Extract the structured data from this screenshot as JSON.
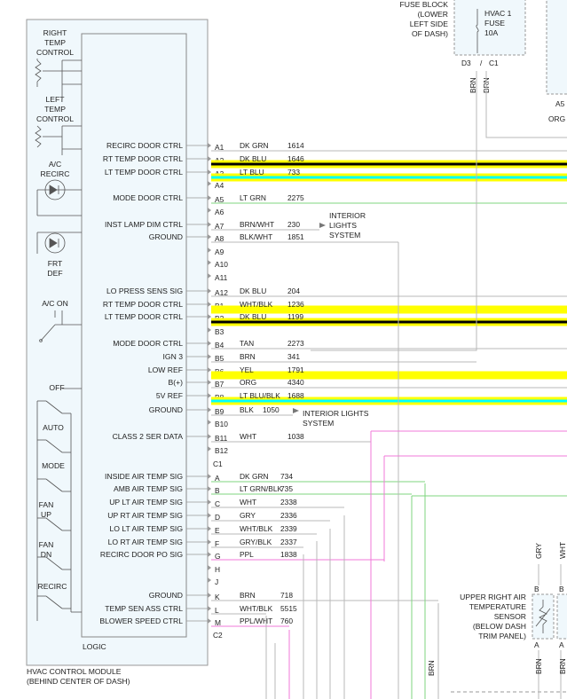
{
  "module": {
    "title_line1": "HVAC CONTROL MODULE",
    "title_line2": "(BEHIND CENTER OF DASH)",
    "logic_label": "LOGIC"
  },
  "switches": {
    "right_temp": [
      "RIGHT",
      "TEMP",
      "CONTROL"
    ],
    "left_temp": [
      "LEFT",
      "TEMP",
      "CONTROL"
    ],
    "ac_recirc": [
      "A/C",
      "RECIRC"
    ],
    "frt_def": [
      "FRT",
      "DEF"
    ],
    "ac_on": "A/C ON",
    "off": "OFF",
    "auto": "AUTO",
    "mode": "MODE",
    "fan_up": [
      "FAN",
      "UP"
    ],
    "fan_dn": [
      "FAN",
      "DN"
    ],
    "recirc": "RECIRC"
  },
  "fuse": {
    "block": [
      "FUSE BLOCK",
      "(LOWER",
      "LEFT SIDE",
      "OF DASH)"
    ],
    "fuse": [
      "HVAC 1",
      "FUSE",
      "10A"
    ],
    "pin_d3": "D3",
    "pin_c1": "C1",
    "wire_1": "BRN",
    "wire_2": "BRN",
    "pin_a5": "A5",
    "wire_org": "ORG"
  },
  "connector_labels": {
    "c1": "C1",
    "c2": "C2"
  },
  "circuits": [
    {
      "signal": "RECIRC DOOR CTRL",
      "pin": "A1",
      "color": "DK GRN",
      "num": "1614"
    },
    {
      "signal": "RT TEMP DOOR CTRL",
      "pin": "A2",
      "color": "DK BLU",
      "num": "1646"
    },
    {
      "signal": "LT TEMP DOOR CTRL",
      "pin": "A3",
      "color": "LT BLU",
      "num": "733"
    },
    {
      "signal": "",
      "pin": "A4",
      "color": "",
      "num": ""
    },
    {
      "signal": "MODE DOOR CTRL",
      "pin": "A5",
      "color": "LT GRN",
      "num": "2275"
    },
    {
      "signal": "",
      "pin": "A6",
      "color": "",
      "num": ""
    },
    {
      "signal": "INST LAMP DIM CTRL",
      "pin": "A7",
      "color": "BRN/WHT",
      "num": "230"
    },
    {
      "signal": "GROUND",
      "pin": "A8",
      "color": "BLK/WHT",
      "num": "1851"
    },
    {
      "signal": "",
      "pin": "A9",
      "color": "",
      "num": ""
    },
    {
      "signal": "",
      "pin": "A10",
      "color": "",
      "num": ""
    },
    {
      "signal": "",
      "pin": "A11",
      "color": "",
      "num": ""
    },
    {
      "signal": "LO PRESS SENS SIG",
      "pin": "A12",
      "color": "DK BLU",
      "num": "204"
    },
    {
      "signal": "RT TEMP DOOR CTRL",
      "pin": "B1",
      "color": "WHT/BLK",
      "num": "1236"
    },
    {
      "signal": "LT TEMP DOOR CTRL",
      "pin": "B2",
      "color": "DK BLU",
      "num": "1199"
    },
    {
      "signal": "",
      "pin": "B3",
      "color": "",
      "num": ""
    },
    {
      "signal": "MODE DOOR CTRL",
      "pin": "B4",
      "color": "TAN",
      "num": "2273"
    },
    {
      "signal": "IGN 3",
      "pin": "B5",
      "color": "BRN",
      "num": "341"
    },
    {
      "signal": "LOW REF",
      "pin": "B6",
      "color": "YEL",
      "num": "1791"
    },
    {
      "signal": "B(+)",
      "pin": "B7",
      "color": "ORG",
      "num": "4340"
    },
    {
      "signal": "5V REF",
      "pin": "B8",
      "color": "LT BLU/BLK",
      "num": "1688"
    },
    {
      "signal": "GROUND",
      "pin": "B9",
      "color": "BLK",
      "num": "1050"
    },
    {
      "signal": "",
      "pin": "B10",
      "color": "",
      "num": ""
    },
    {
      "signal": "CLASS 2 SER DATA",
      "pin": "B11",
      "color": "WHT",
      "num": "1038"
    },
    {
      "signal": "",
      "pin": "B12",
      "color": "",
      "num": ""
    }
  ],
  "circuits_c2": [
    {
      "signal": "INSIDE AIR TEMP SIG",
      "pin": "A",
      "color": "DK GRN",
      "num": "734"
    },
    {
      "signal": "AMB AIR TEMP SIG",
      "pin": "B",
      "color": "LT GRN/BLK",
      "num": "735"
    },
    {
      "signal": "UP LT AIR TEMP SIG",
      "pin": "C",
      "color": "WHT",
      "num": "2338"
    },
    {
      "signal": "UP RT AIR TEMP SIG",
      "pin": "D",
      "color": "GRY",
      "num": "2336"
    },
    {
      "signal": "LO LT AIR TEMP SIG",
      "pin": "E",
      "color": "WHT/BLK",
      "num": "2339"
    },
    {
      "signal": "LO RT AIR TEMP SIG",
      "pin": "F",
      "color": "GRY/BLK",
      "num": "2337"
    },
    {
      "signal": "RECIRC DOOR PO SIG",
      "pin": "G",
      "color": "PPL",
      "num": "1838"
    },
    {
      "signal": "",
      "pin": "H",
      "color": "",
      "num": ""
    },
    {
      "signal": "",
      "pin": "J",
      "color": "",
      "num": ""
    },
    {
      "signal": "GROUND",
      "pin": "K",
      "color": "BRN",
      "num": "718"
    },
    {
      "signal": "TEMP SEN ASS CTRL",
      "pin": "L",
      "color": "WHT/BLK",
      "num": "5515"
    },
    {
      "signal": "BLOWER SPEED CTRL",
      "pin": "M",
      "color": "PPL/WHT",
      "num": "760"
    }
  ],
  "refs": {
    "interior_lights_a7": [
      "INTERIOR",
      "LIGHTS",
      "SYSTEM"
    ],
    "interior_lights_b9": [
      "INTERIOR LIGHTS",
      "SYSTEM"
    ]
  },
  "sensor": {
    "name": [
      "UPPER RIGHT AIR",
      "TEMPERATURE",
      "SENSOR",
      "(BELOW DASH",
      "TRIM PANEL)"
    ],
    "wire_gry": "GRY",
    "wire_wht": "WHT",
    "pin_b_left": "B",
    "pin_b_right": "B",
    "pin_a_left": "A",
    "pin_a_right": "A",
    "wire_brn_left": "BRN",
    "wire_brn_right": "BRN",
    "wire_brn_bottom": "BRN"
  },
  "highlight_colors": {
    "yellow": "#ffff00",
    "cyan": "#00ffff",
    "black": "#000000",
    "green_wire": "#7fd67f",
    "pink_wire": "#f07ad8",
    "gray_wire": "#b8b8b8"
  }
}
